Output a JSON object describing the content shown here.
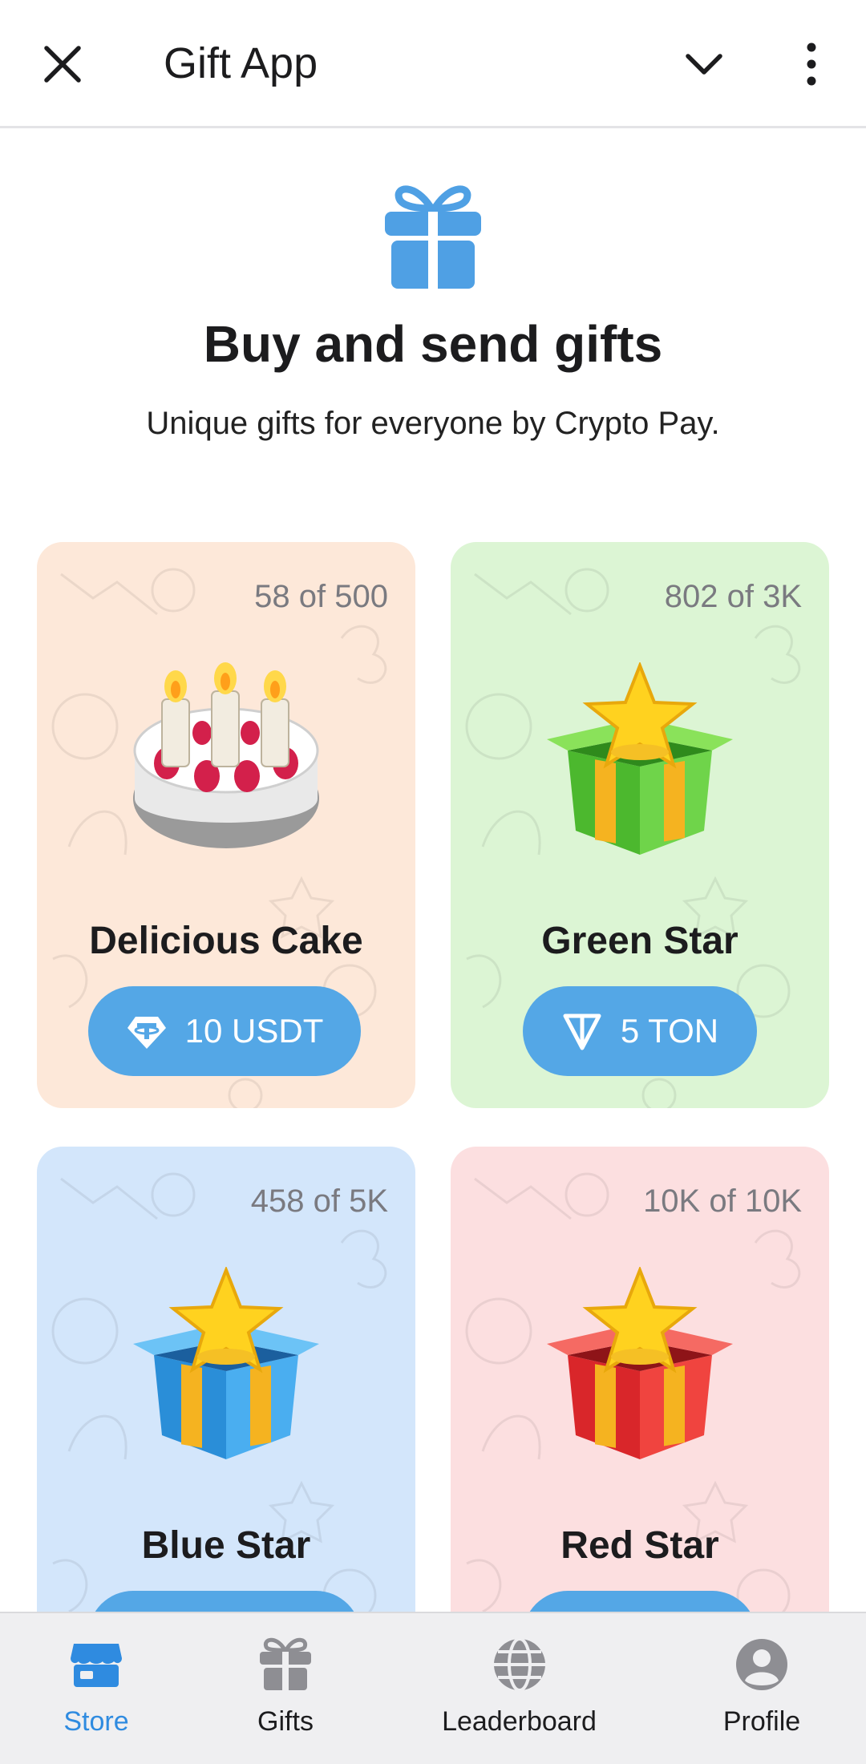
{
  "header": {
    "title": "Gift App",
    "icons": [
      "close-icon",
      "chevron-down-icon",
      "more-vertical-icon"
    ]
  },
  "hero": {
    "icon": "gift-icon",
    "title": "Buy and send gifts",
    "subtitle": "Unique gifts for everyone by Crypto Pay."
  },
  "gifts": [
    {
      "count": "58 of 500",
      "name": "Delicious Cake",
      "price": "10 USDT",
      "currency_icon": "tether-icon",
      "background": "#fde8d9"
    },
    {
      "count": "802 of 3K",
      "name": "Green Star",
      "price": "5 TON",
      "currency_icon": "ton-icon",
      "background": "#dcf5d4"
    },
    {
      "count": "458 of 5K",
      "name": "Blue Star",
      "price": "",
      "currency_icon": "",
      "background": "#d3e6fb"
    },
    {
      "count": "10K of 10K",
      "name": "Red Star",
      "price": "",
      "currency_icon": "",
      "background": "#fcdfe0"
    }
  ],
  "nav": {
    "items": [
      {
        "label": "Store",
        "icon": "store-icon",
        "active": true
      },
      {
        "label": "Gifts",
        "icon": "gift-icon",
        "active": false
      },
      {
        "label": "Leaderboard",
        "icon": "globe-icon",
        "active": false
      },
      {
        "label": "Profile",
        "icon": "profile-icon",
        "active": false
      }
    ]
  },
  "colors": {
    "accent": "#54a7e6",
    "active_nav": "#2f8be0"
  }
}
